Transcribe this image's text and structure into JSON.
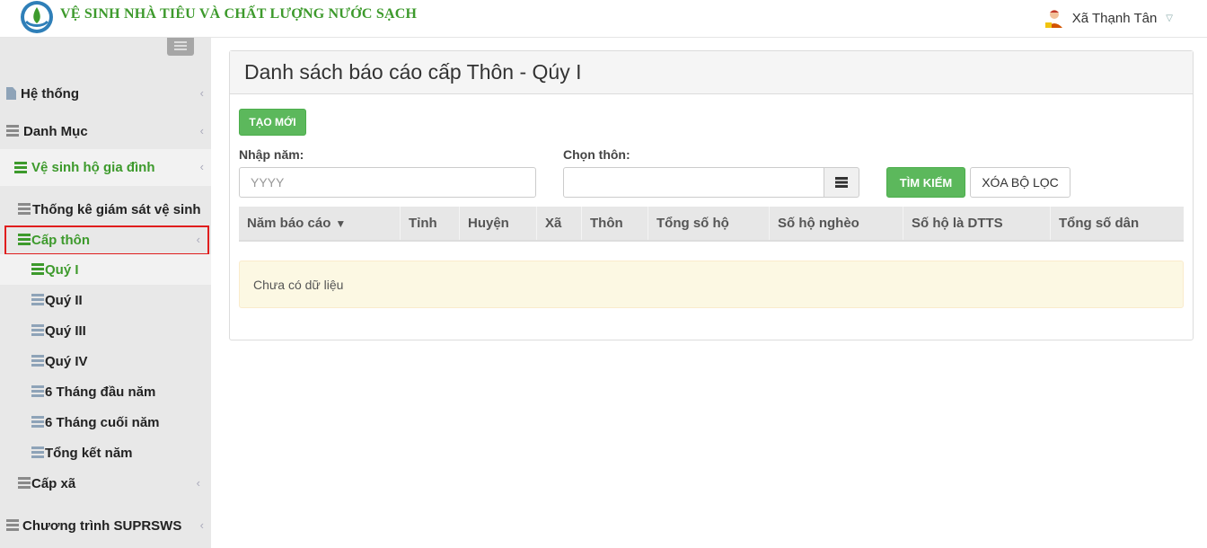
{
  "header": {
    "app_title": "VỆ SINH NHÀ TIÊU VÀ CHẤT LƯỢNG NƯỚC SẠCH",
    "user_name": "Xã Thạnh Tân"
  },
  "sidebar": {
    "items": [
      {
        "label": "Hệ thống",
        "icon": "document-icon"
      },
      {
        "label": "Danh Mục",
        "icon": "list-icon"
      },
      {
        "label": "Vệ sinh hộ gia đình",
        "icon": "list-icon",
        "state": "open"
      },
      {
        "label": "Thống kê giám sát vệ sinh",
        "icon": "list-icon"
      },
      {
        "label": "Cấp thôn",
        "icon": "list-icon",
        "state": "open"
      },
      {
        "label": "Quý I",
        "icon": "list-icon",
        "state": "active"
      },
      {
        "label": "Quý II",
        "icon": "list-icon"
      },
      {
        "label": "Quý III",
        "icon": "list-icon"
      },
      {
        "label": "Quý IV",
        "icon": "list-icon"
      },
      {
        "label": "6 Tháng đầu năm",
        "icon": "list-icon"
      },
      {
        "label": "6 Tháng cuối năm",
        "icon": "list-icon"
      },
      {
        "label": "Tổng kết năm",
        "icon": "list-icon"
      },
      {
        "label": "Cấp xã",
        "icon": "list-icon"
      },
      {
        "label": "Chương trình SUPRSWS",
        "icon": "list-icon"
      }
    ]
  },
  "main": {
    "panel_title": "Danh sách báo cáo cấp Thôn - Qúy I",
    "create_button": "TẠO MỚI",
    "year_label": "Nhập năm:",
    "year_placeholder": "YYYY",
    "village_label": "Chọn thôn:",
    "village_value": "",
    "search_button": "TÌM KIẾM",
    "clear_button": "XÓA BỘ LỌC",
    "columns": [
      "Năm báo cáo",
      "Tỉnh",
      "Huyện",
      "Xã",
      "Thôn",
      "Tổng số hộ",
      "Số hộ nghèo",
      "Số hộ là DTTS",
      "Tổng số dân"
    ],
    "empty_message": "Chưa có dữ liệu"
  },
  "colors": {
    "brand_green": "#3d9a2c",
    "button_green": "#5cb85c",
    "highlight_red": "#e01e1e"
  }
}
